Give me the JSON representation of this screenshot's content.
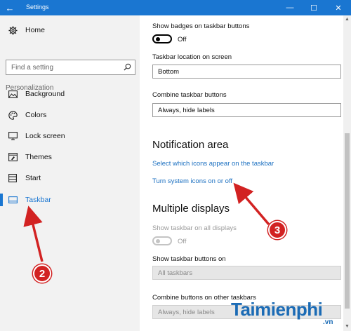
{
  "window": {
    "title": "Settings",
    "controls": {
      "minimize": "—",
      "maximize": "☐",
      "close": "✕"
    }
  },
  "sidebar": {
    "home_label": "Home",
    "search_placeholder": "Find a setting",
    "section_label": "Personalization",
    "items": [
      {
        "label": "Background",
        "icon": "picture-icon"
      },
      {
        "label": "Colors",
        "icon": "palette-icon"
      },
      {
        "label": "Lock screen",
        "icon": "lock-screen-icon"
      },
      {
        "label": "Themes",
        "icon": "themes-icon"
      },
      {
        "label": "Start",
        "icon": "start-icon"
      },
      {
        "label": "Taskbar",
        "icon": "taskbar-icon",
        "active": true
      }
    ]
  },
  "main": {
    "badges_label": "Show badges on taskbar buttons",
    "badges_toggle": "Off",
    "location_label": "Taskbar location on screen",
    "location_value": "Bottom",
    "combine_label": "Combine taskbar buttons",
    "combine_value": "Always, hide labels",
    "notification_heading": "Notification area",
    "link_icons": "Select which icons appear on the taskbar",
    "link_system": "Turn system icons on or off",
    "multiple_heading": "Multiple displays",
    "show_all_label": "Show taskbar on all displays",
    "show_all_toggle": "Off",
    "buttons_on_label": "Show taskbar buttons on",
    "buttons_on_value": "All taskbars",
    "combine_other_label": "Combine buttons on other taskbars",
    "combine_other_value": "Always, hide labels"
  },
  "annotations": {
    "marker_2": "2",
    "marker_3": "3",
    "color": "#d22222"
  },
  "watermark": {
    "brand": "Taimienphi",
    "suffix": ".vn"
  },
  "colors": {
    "accent": "#1a76d1",
    "link": "#1a6fc0",
    "sidebar_bg": "#f2f2f2"
  }
}
